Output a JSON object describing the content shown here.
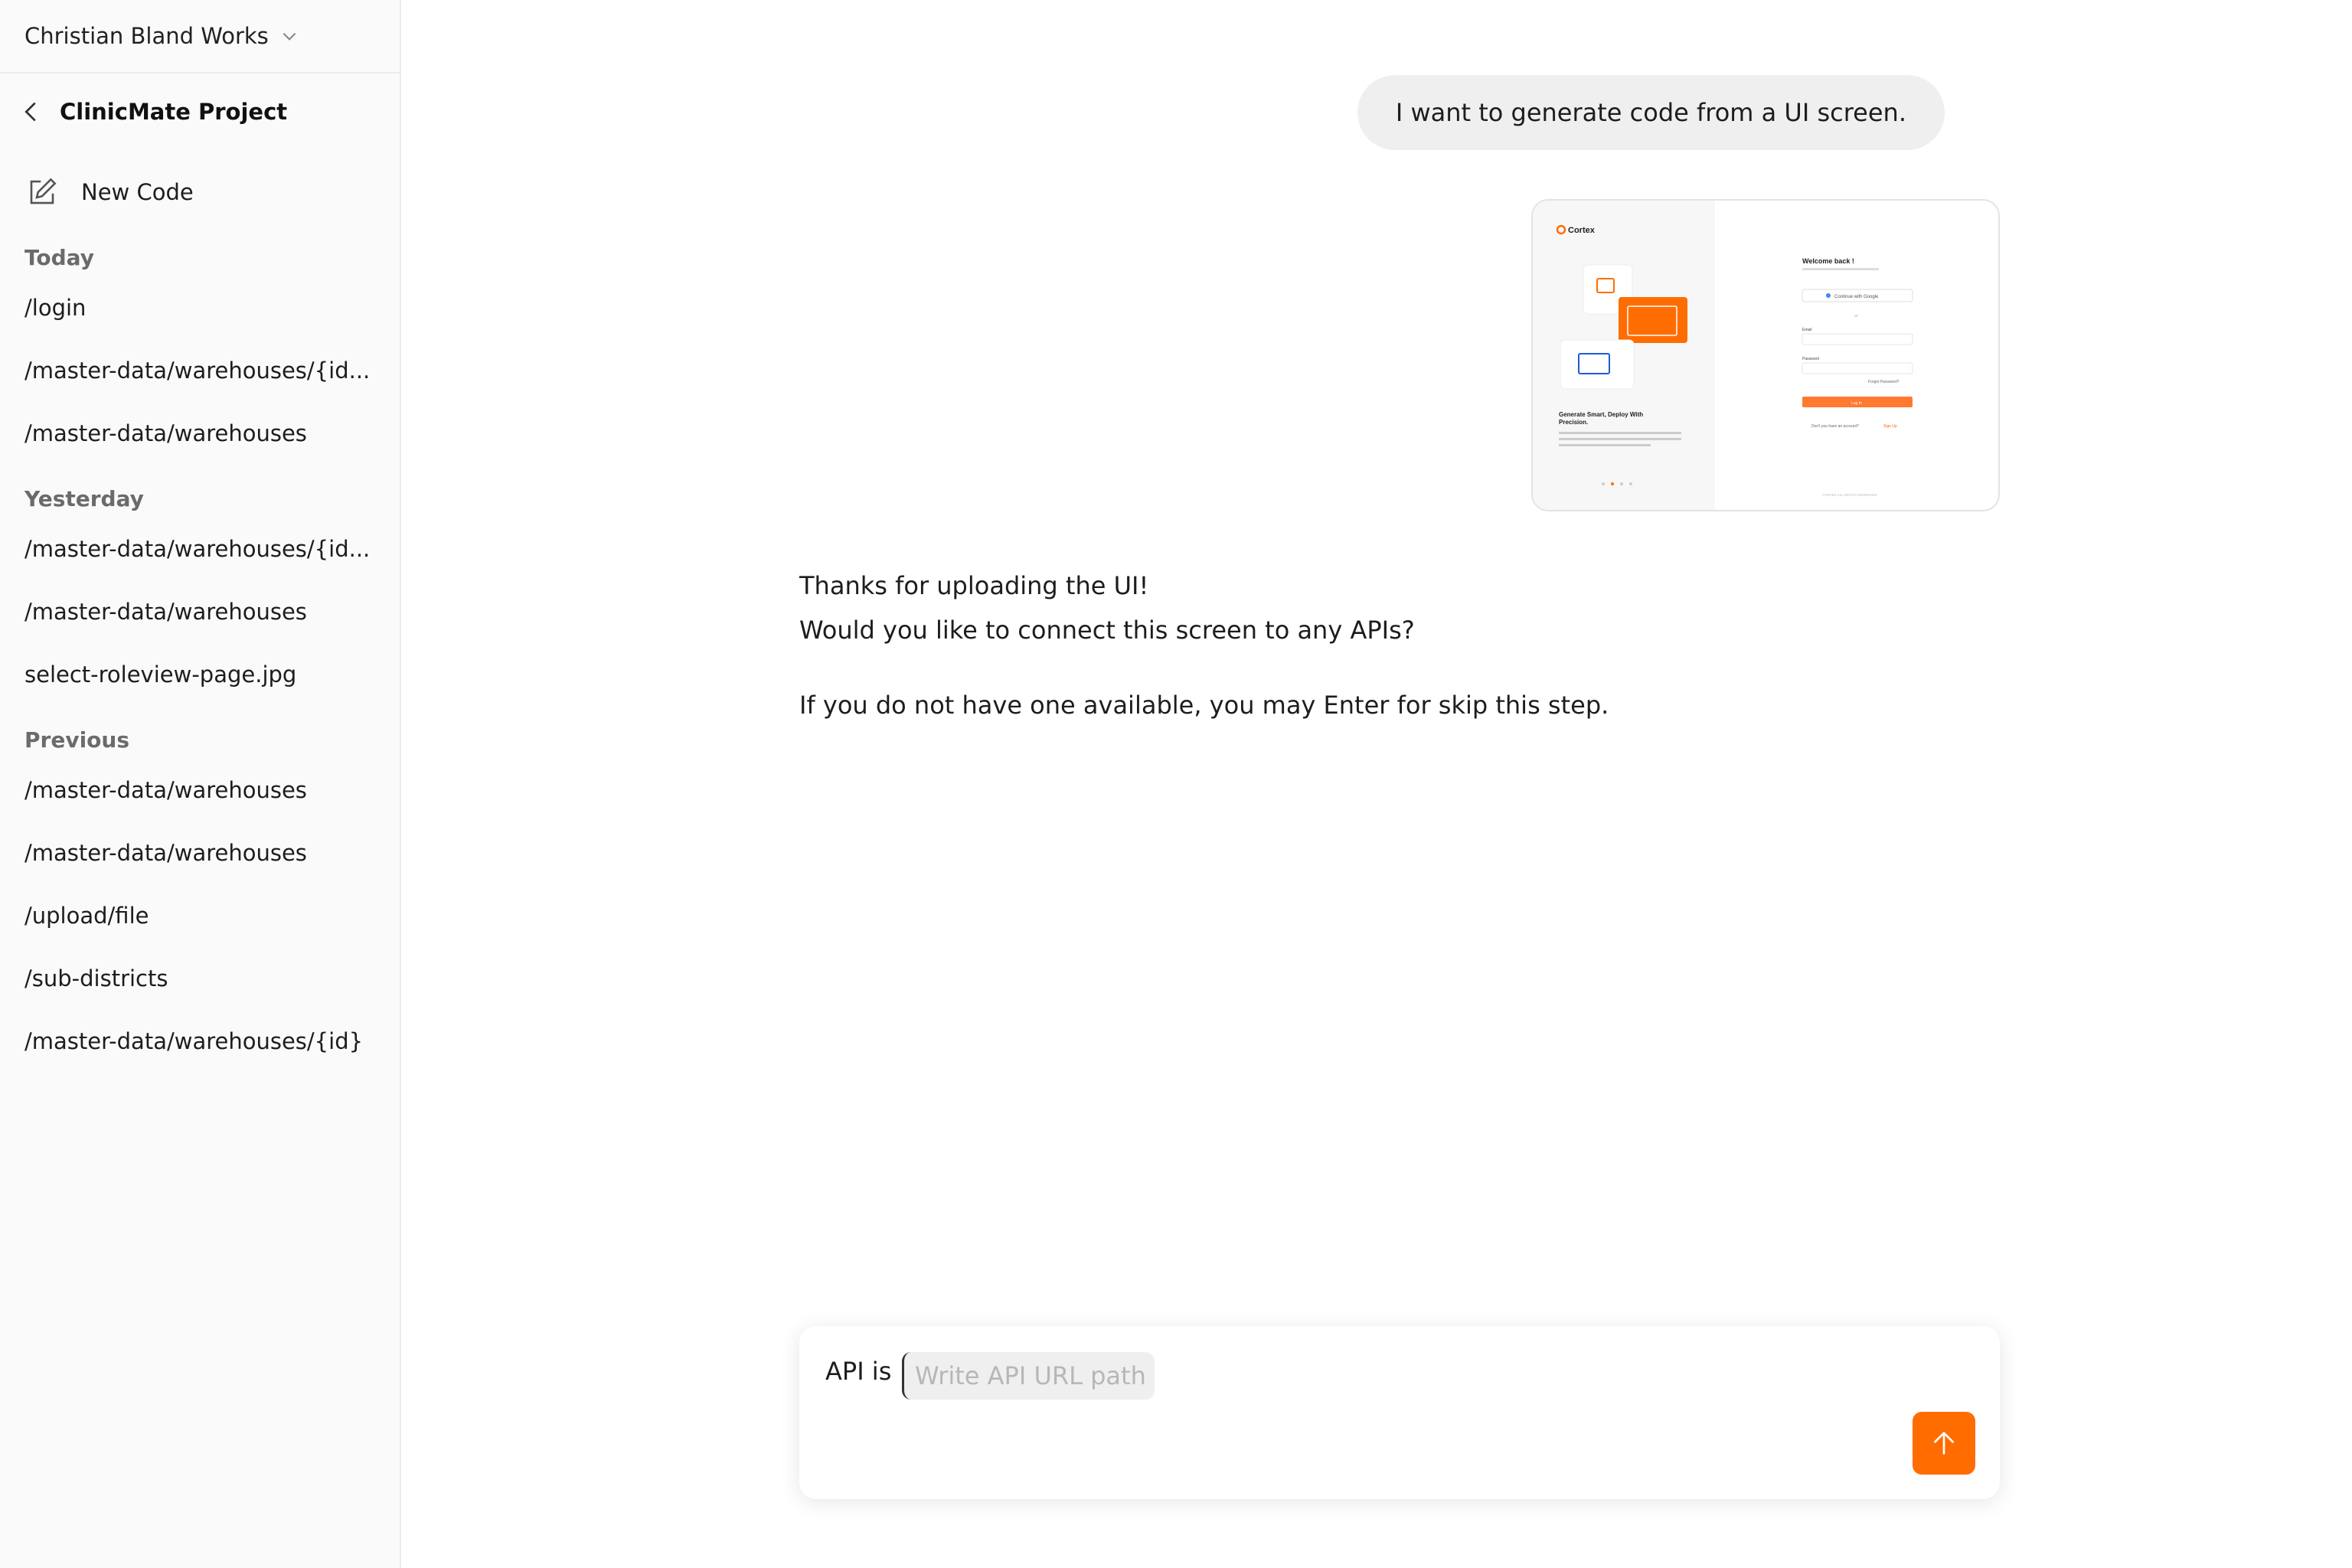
{
  "sidebar": {
    "workspace": "Christian Bland Works",
    "project": "ClinicMate Project",
    "new_code": "New Code",
    "sections": [
      {
        "title": "Today",
        "items": [
          "/login",
          "/master-data/warehouses/{id...",
          "/master-data/warehouses"
        ]
      },
      {
        "title": "Yesterday",
        "items": [
          "/master-data/warehouses/{id...",
          "/master-data/warehouses",
          "select-roleview-page.jpg"
        ]
      },
      {
        "title": "Previous",
        "items": [
          "/master-data/warehouses",
          "/master-data/warehouses",
          "/upload/file",
          "/sub-districts",
          "/master-data/warehouses/{id}"
        ]
      }
    ]
  },
  "chat": {
    "user_message": "I want to generate code from a UI screen.",
    "attachment": {
      "brand": "Cortex",
      "heading": "Welcome back !",
      "subheading": "Start managing your project faster and better",
      "google_button": "Continue with Google",
      "or": "or",
      "email_label": "Email",
      "email_placeholder": "Email",
      "password_label": "Password",
      "password_placeholder": "Password",
      "forgot": "Forgot Password?",
      "login_button": "Log In",
      "signup_prompt": "Don't you have an account?",
      "signup_link": "Sign Up",
      "tagline": "Generate Smart, Deploy With Precision.",
      "footer": "CORTEX ALL RIGHTS RESERVED"
    },
    "assistant_lines": [
      "Thanks for uploading the UI!",
      "Would you like to connect this screen to any APIs?",
      "If you do not have one available, you may Enter for skip this step."
    ]
  },
  "composer": {
    "prefix": "API is",
    "placeholder": "Write API URL path",
    "value": ""
  },
  "colors": {
    "accent": "#ff6d00",
    "sidebar_bg": "#fafafa",
    "bubble_bg": "#efefef"
  }
}
